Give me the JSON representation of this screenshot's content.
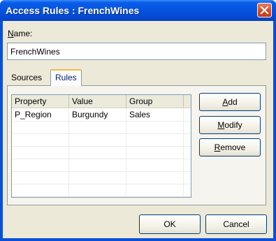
{
  "window": {
    "title": "Access Rules : FrenchWines"
  },
  "form": {
    "name_label": "Name:",
    "name_value": "FrenchWines"
  },
  "tabs": [
    {
      "label": "Sources"
    },
    {
      "label": "Rules"
    }
  ],
  "table": {
    "headers": [
      "Property",
      "Value",
      "Group"
    ],
    "rows": [
      [
        "P_Region",
        "Burgundy",
        "Sales"
      ]
    ]
  },
  "buttons": {
    "add": "Add",
    "modify": "Modify",
    "remove": "Remove",
    "ok": "OK",
    "cancel": "Cancel"
  },
  "icons": {
    "close": "close-icon"
  },
  "colors": {
    "title_bar": "#0553e0",
    "close_button": "#d24d28",
    "dialog_bg": "#ece9d8",
    "active_tab_accent": "#f7b74a"
  }
}
